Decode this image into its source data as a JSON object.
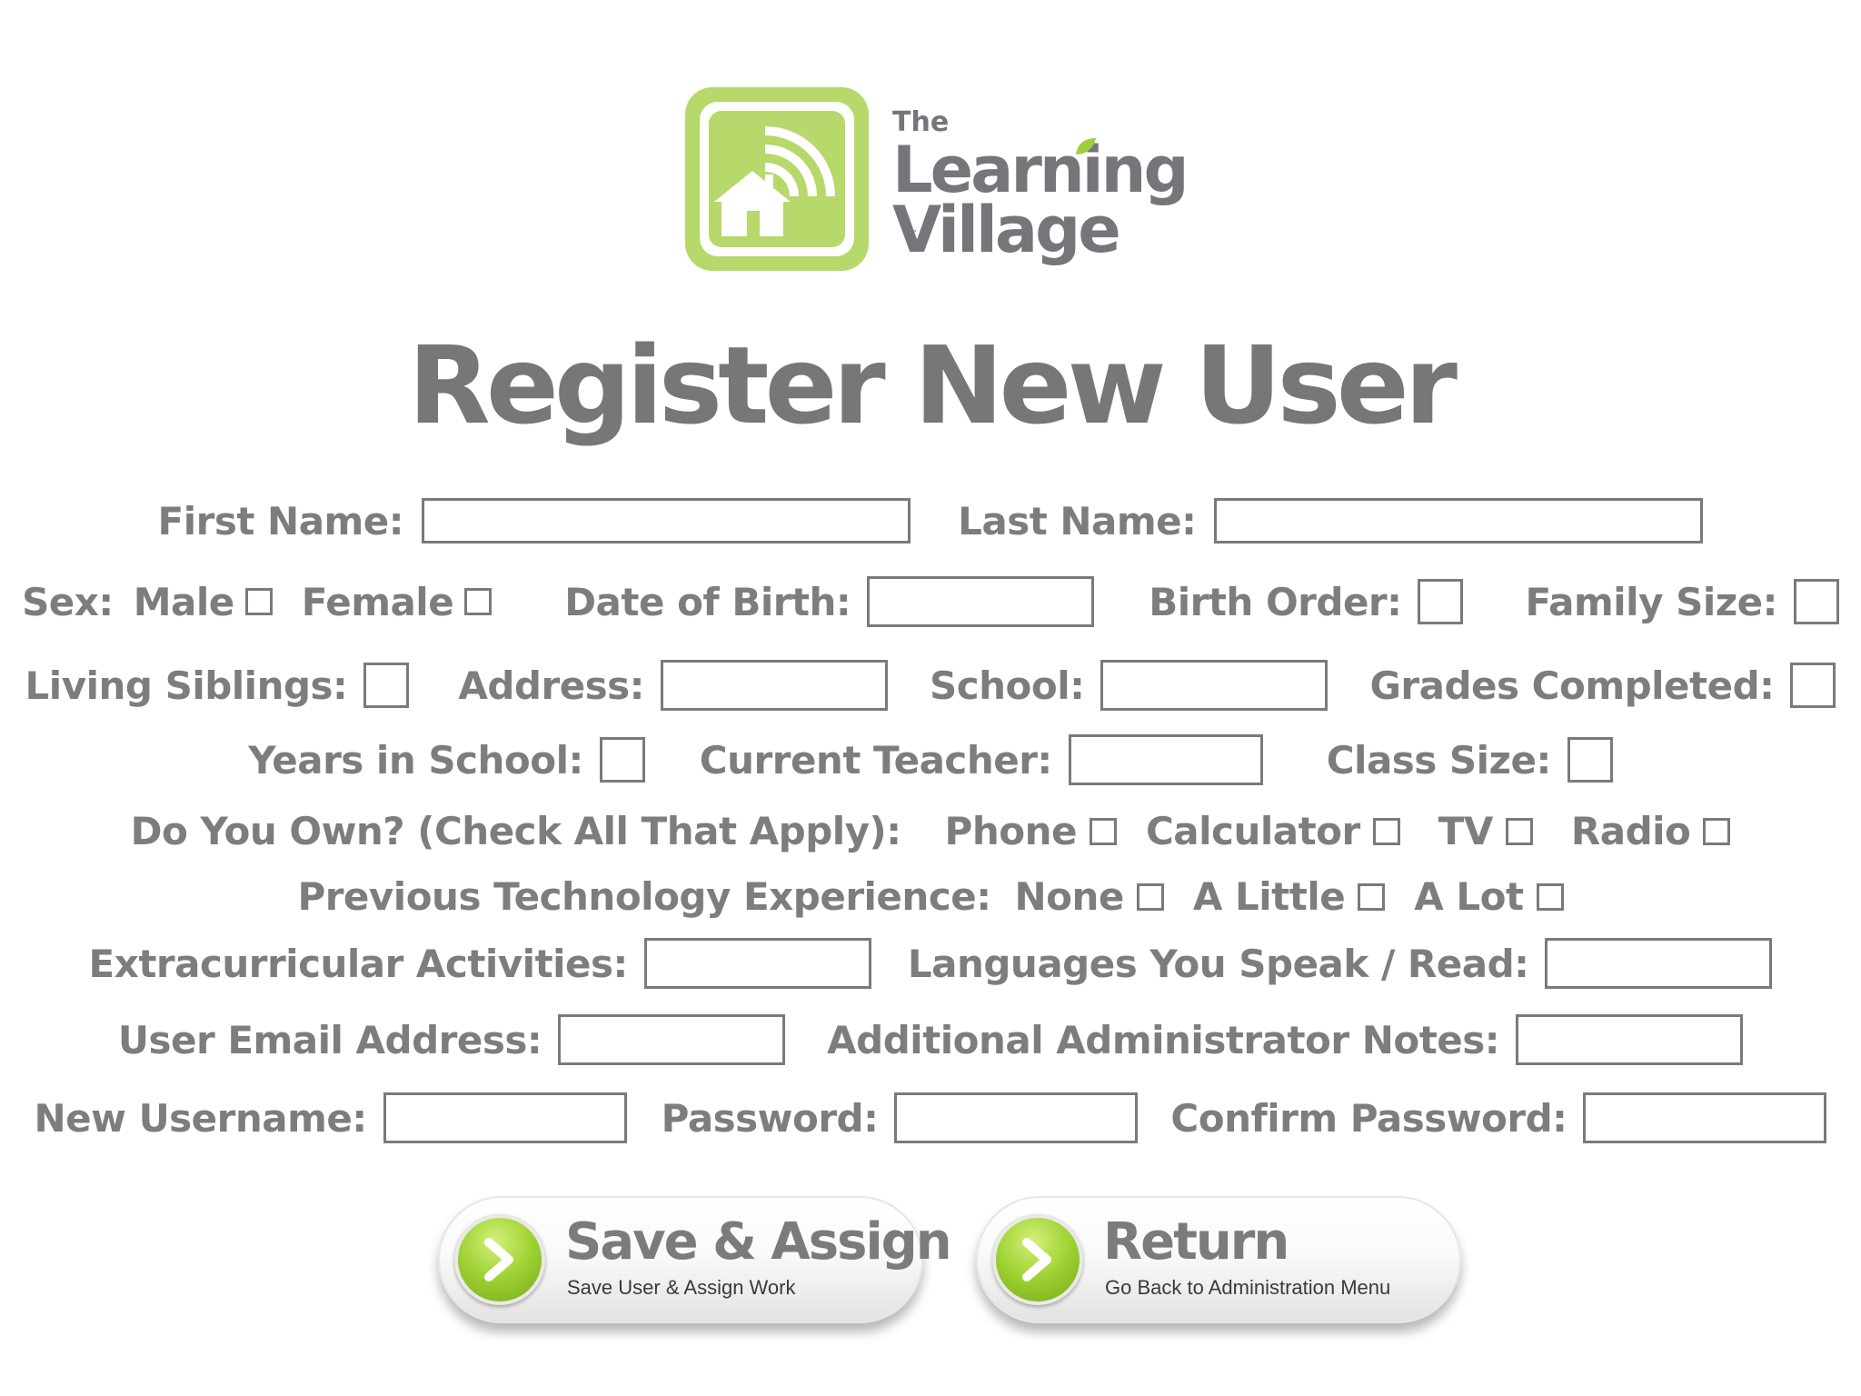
{
  "logo": {
    "the": "The",
    "learning": "Learning",
    "village": "Village",
    "tm": "™",
    "colors": {
      "green": "#b7d86a",
      "gray": "#75757a"
    }
  },
  "title": "Register New User",
  "fields": {
    "first_name": "First Name:",
    "last_name": "Last Name:",
    "sex": "Sex:",
    "male": "Male",
    "female": "Female",
    "date_of_birth": "Date of Birth:",
    "birth_order": "Birth Order:",
    "family_size": "Family Size:",
    "living_siblings": "Living Siblings:",
    "address": "Address:",
    "school": "School:",
    "grades_completed": "Grades Completed:",
    "years_in_school": "Years in School:",
    "current_teacher": "Current Teacher:",
    "class_size": "Class Size:",
    "do_you_own": "Do You Own? (Check All That Apply):",
    "phone": "Phone",
    "calculator": "Calculator",
    "tv": "TV",
    "radio": "Radio",
    "prev_tech": "Previous Technology Experience:",
    "none": "None",
    "a_little": "A Little",
    "a_lot": "A Lot",
    "extracurricular": "Extracurricular Activities:",
    "languages": "Languages You Speak / Read:",
    "user_email": "User Email Address:",
    "admin_notes": "Additional Administrator Notes:",
    "new_username": "New Username:",
    "password": "Password:",
    "confirm_password": "Confirm Password:"
  },
  "buttons": {
    "save": {
      "title": "Save & Assign",
      "subtitle": "Save User & Assign Work"
    },
    "return": {
      "title": "Return",
      "subtitle": "Go Back to Administration Menu"
    }
  },
  "colors": {
    "text_gray": "#7d7d80",
    "accent_green": "#9fd233"
  }
}
